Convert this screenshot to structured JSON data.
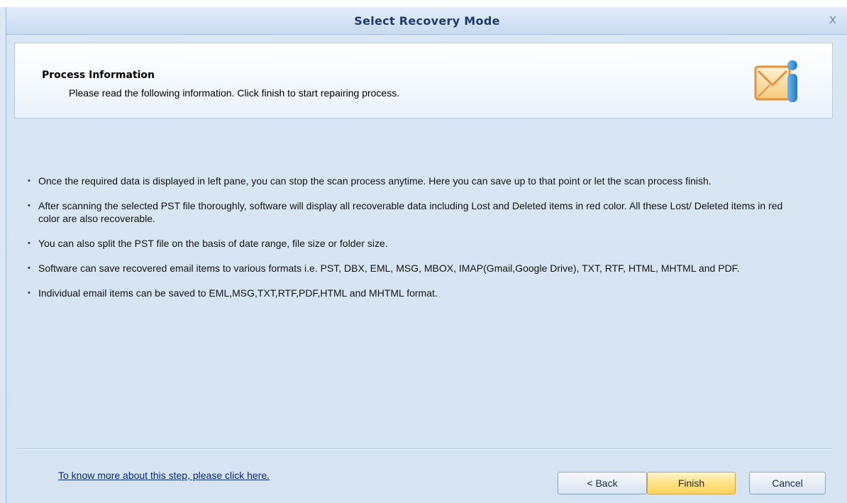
{
  "window": {
    "title": "Select Recovery Mode",
    "close_glyph": "x"
  },
  "header": {
    "title": "Process Information",
    "subtitle": "Please read the following information. Click finish to start repairing process.",
    "icon": "mail-info-icon"
  },
  "bullets": [
    "Once the required data is displayed in left pane, you can stop the scan process anytime. Here you can save up to that point or let the scan process finish.",
    "After scanning the selected PST file thoroughly, software will display all recoverable data including Lost and Deleted items in red color. All these Lost/ Deleted items in red color are also recoverable.",
    "You can also split the PST file on the basis of date range, file size or folder size.",
    "Software can save recovered email items to various formats i.e. PST, DBX, EML, MSG, MBOX, IMAP(Gmail,Google Drive), TXT, RTF, HTML, MHTML and PDF.",
    "Individual email items can be saved to EML,MSG,TXT,RTF,PDF,HTML and MHTML format."
  ],
  "footer": {
    "help_link": "To know more about this step, please click here.",
    "back_label": "< Back",
    "finish_label": "Finish",
    "cancel_label": "Cancel"
  },
  "colors": {
    "title_text": "#1f3a6b",
    "dialog_bg": "#d9e6f4",
    "finish_button": "#ffd25a"
  }
}
